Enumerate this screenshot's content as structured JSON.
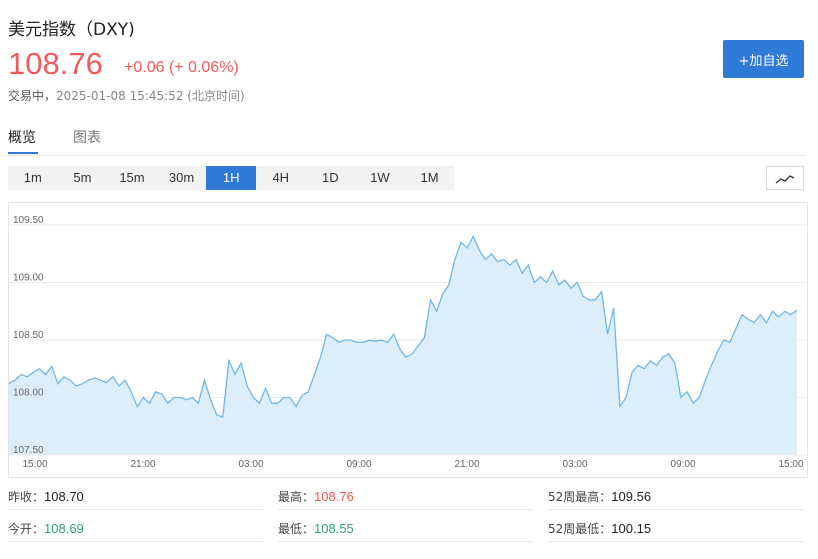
{
  "header": {
    "title": "美元指数（DXY)",
    "price": "108.76",
    "change": "+0.06 (+ 0.06%)",
    "status": "交易中，",
    "timestamp": "2025-01-08 15:45:52 (北京时间)",
    "add_button": "+加自选",
    "colors": {
      "up": "#f25a5a",
      "accent": "#2f79d7",
      "down": "#2fa37c"
    }
  },
  "tabs": [
    {
      "label": "概览",
      "active": true
    },
    {
      "label": "图表",
      "active": false
    }
  ],
  "intervals": [
    {
      "label": "1m",
      "active": false
    },
    {
      "label": "5m",
      "active": false
    },
    {
      "label": "15m",
      "active": false
    },
    {
      "label": "30m",
      "active": false
    },
    {
      "label": "1H",
      "active": true
    },
    {
      "label": "4H",
      "active": false
    },
    {
      "label": "1D",
      "active": false
    },
    {
      "label": "1W",
      "active": false
    },
    {
      "label": "1M",
      "active": false
    }
  ],
  "chart_toggle_icon": "line-chart-icon",
  "chart_data": {
    "type": "area",
    "ylim": [
      107.5,
      109.5
    ],
    "y_ticks": [
      "109.50",
      "109.00",
      "108.50",
      "108.00",
      "107.50"
    ],
    "x_ticks": [
      "15:00",
      "21:00",
      "03:00",
      "09:00",
      "21:00",
      "03:00",
      "09:00",
      "15:00"
    ],
    "grid": true,
    "line_color": "#72b7ea",
    "fill_color": "#ddeefb",
    "values": [
      108.12,
      108.15,
      108.2,
      108.18,
      108.22,
      108.25,
      108.2,
      108.27,
      108.12,
      108.18,
      108.15,
      108.1,
      108.12,
      108.15,
      108.17,
      108.15,
      108.13,
      108.18,
      108.1,
      108.15,
      108.05,
      107.92,
      108.0,
      107.95,
      108.05,
      108.03,
      107.95,
      108.0,
      108.0,
      107.98,
      108.0,
      107.95,
      108.15,
      107.98,
      107.85,
      107.83,
      108.32,
      108.2,
      108.3,
      108.1,
      108.0,
      107.95,
      108.08,
      107.95,
      107.95,
      108.0,
      108.0,
      107.92,
      108.02,
      108.05,
      108.2,
      108.35,
      108.55,
      108.52,
      108.48,
      108.5,
      108.5,
      108.48,
      108.48,
      108.5,
      108.49,
      108.5,
      108.48,
      108.55,
      108.42,
      108.35,
      108.38,
      108.45,
      108.52,
      108.85,
      108.75,
      108.9,
      108.98,
      109.2,
      109.35,
      109.3,
      109.4,
      109.28,
      109.2,
      109.25,
      109.18,
      109.2,
      109.15,
      109.2,
      109.08,
      109.15,
      109.0,
      109.05,
      109.0,
      109.1,
      108.98,
      109.02,
      108.95,
      109.0,
      108.88,
      108.85,
      108.85,
      108.92,
      108.55,
      108.78,
      107.92,
      108.0,
      108.22,
      108.28,
      108.25,
      108.32,
      108.28,
      108.35,
      108.38,
      108.3,
      108.0,
      108.05,
      107.95,
      108.0,
      108.15,
      108.28,
      108.4,
      108.5,
      108.48,
      108.6,
      108.72,
      108.68,
      108.65,
      108.72,
      108.65,
      108.75,
      108.7,
      108.75,
      108.72,
      108.76
    ]
  },
  "stats": {
    "prev_close_label": "昨收：",
    "prev_close": "108.70",
    "high_label": "最高：",
    "high": "108.76",
    "wk52_high_label": "52周最高：",
    "wk52_high": "109.56",
    "open_label": "今开：",
    "open": "108.69",
    "low_label": "最低：",
    "low": "108.55",
    "wk52_low_label": "52周最低：",
    "wk52_low": "100.15"
  }
}
